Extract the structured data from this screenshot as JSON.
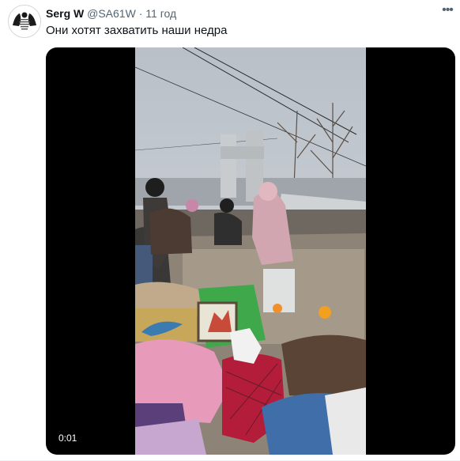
{
  "tweet": {
    "author_name": "Serg W",
    "author_handle": "@SA61W",
    "separator": "·",
    "time": "11 год",
    "text": "Они хотят захватить наши недра",
    "more_icon": "more-horizontal-icon"
  },
  "video": {
    "duration": "0:01"
  },
  "colors": {
    "text_primary": "#0f1419",
    "text_secondary": "#536471",
    "media_bg": "#000000"
  }
}
